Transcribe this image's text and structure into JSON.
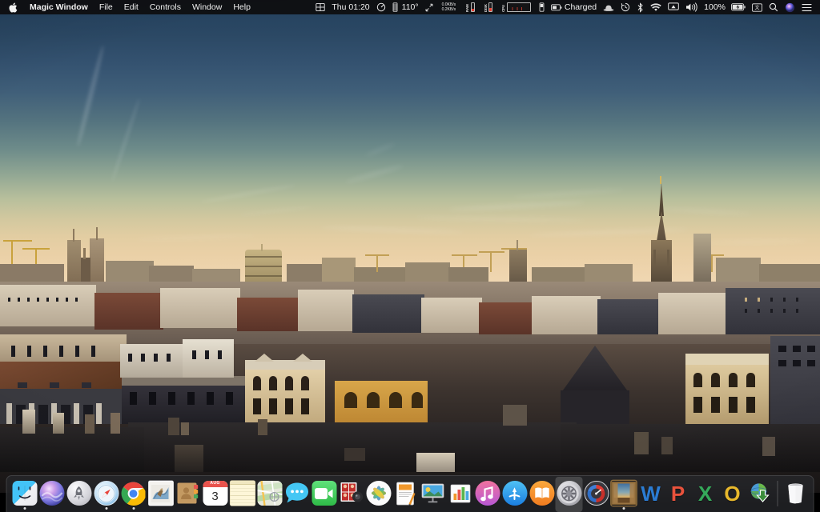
{
  "menubar": {
    "apple_icon": "apple-logo-icon",
    "app_menus": [
      {
        "label": "Magic Window",
        "bold": true,
        "name": "menu-app-name"
      },
      {
        "label": "File",
        "bold": false,
        "name": "menu-file"
      },
      {
        "label": "Edit",
        "bold": false,
        "name": "menu-edit"
      },
      {
        "label": "Controls",
        "bold": false,
        "name": "menu-controls"
      },
      {
        "label": "Window",
        "bold": false,
        "name": "menu-window"
      },
      {
        "label": "Help",
        "bold": false,
        "name": "menu-help"
      }
    ],
    "status": {
      "grid_icon": "grid-view-icon",
      "clock": "Thu 01:20",
      "speedometer_icon": "speedometer-icon",
      "temperature": "110°",
      "fan_icon": "fan-speed-icon",
      "expand_icon": "resize-arrows-icon",
      "net_up": "0.0KB/s",
      "net_down": "0.2KB/s",
      "ram_label": "RAM",
      "disk_label": "DISK",
      "cpu_label": "CPU",
      "battery_glyph_icon": "battery-icon",
      "charge_state": "Charged",
      "bartender_icon": "bowler-hat-icon",
      "timemachine_icon": "time-machine-icon",
      "bluetooth_icon": "bluetooth-icon",
      "wifi_icon": "wifi-icon",
      "airplay_icon": "airplay-icon",
      "volume_icon": "volume-icon",
      "battery_percent": "100%",
      "battery_charging_icon": "battery-charging-icon",
      "input_source_icon": "input-source-icon",
      "spotlight_icon": "search-icon",
      "siri_icon": "siri-icon",
      "notification_center_icon": "list-lines-icon"
    }
  },
  "dock": {
    "items": [
      {
        "label": "Finder",
        "icon": "finder-icon",
        "running": true
      },
      {
        "label": "Siri",
        "icon": "siri-icon",
        "running": false
      },
      {
        "label": "Launchpad",
        "icon": "launchpad-rocket-icon",
        "running": false
      },
      {
        "label": "Safari",
        "icon": "safari-compass-icon",
        "running": true
      },
      {
        "label": "Google Chrome",
        "icon": "chrome-icon",
        "running": true
      },
      {
        "label": "Mail",
        "icon": "mail-stamp-icon",
        "running": false
      },
      {
        "label": "Contacts",
        "icon": "contacts-book-icon",
        "running": false
      },
      {
        "label": "Calendar",
        "icon": "calendar-icon",
        "running": false
      },
      {
        "label": "Notes",
        "icon": "notes-icon",
        "running": false
      },
      {
        "label": "Maps",
        "icon": "maps-icon",
        "running": false
      },
      {
        "label": "Messages",
        "icon": "messages-bubble-icon",
        "running": false
      },
      {
        "label": "FaceTime",
        "icon": "facetime-icon",
        "running": false
      },
      {
        "label": "Photo Booth",
        "icon": "photo-booth-icon",
        "running": false
      },
      {
        "label": "Photos",
        "icon": "photos-pinwheel-icon",
        "running": false
      },
      {
        "label": "Pages",
        "icon": "pages-icon",
        "running": false
      },
      {
        "label": "Keynote",
        "icon": "keynote-icon",
        "running": false
      },
      {
        "label": "Numbers",
        "icon": "numbers-icon",
        "running": false
      },
      {
        "label": "iTunes",
        "icon": "itunes-note-icon",
        "running": false
      },
      {
        "label": "App Store",
        "icon": "app-store-icon",
        "running": false
      },
      {
        "label": "iBooks",
        "icon": "ibooks-icon",
        "running": false
      },
      {
        "label": "System Preferences",
        "icon": "system-preferences-gear-icon",
        "running": false
      },
      {
        "label": "Activity Monitor",
        "icon": "activity-monitor-icon",
        "running": false
      },
      {
        "label": "Magic Window",
        "icon": "magic-window-icon",
        "running": true
      },
      {
        "label": "Microsoft Word",
        "icon": "word-icon",
        "running": false
      },
      {
        "label": "Microsoft PowerPoint",
        "icon": "powerpoint-icon",
        "running": false
      },
      {
        "label": "Microsoft Excel",
        "icon": "excel-icon",
        "running": false
      },
      {
        "label": "Microsoft Outlook",
        "icon": "outlook-icon",
        "running": false
      },
      {
        "label": "Downloads",
        "icon": "download-globe-icon",
        "running": false
      }
    ],
    "calendar_month": "AUG",
    "calendar_day": "3",
    "word_glyph": "W",
    "powerpoint_glyph": "P",
    "excel_glyph": "X",
    "outlook_glyph": "O",
    "trash_label": "Trash",
    "trash_icon": "trash-icon"
  },
  "desktop": {
    "wallpaper_name": "Brussels skyline at sunset",
    "sky_top_color": "#23405d",
    "sky_horizon_color": "#f0d8b4",
    "accent_gold": "#d8a64a"
  }
}
